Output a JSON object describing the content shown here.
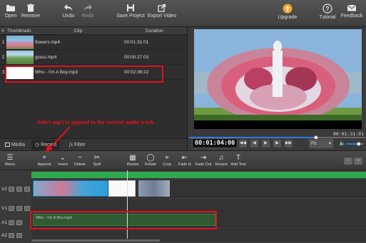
{
  "toolbar": {
    "open": "Open",
    "remove": "Remove",
    "undo": "Undo",
    "redo": "Redo",
    "save_project": "Save Project",
    "export_video": "Export Video",
    "upgrade": "Upgrade",
    "tutorial": "Tutorial",
    "feedback": "Feedback"
  },
  "media": {
    "columns": {
      "num": "#",
      "thumbnails": "Thumbnails",
      "clip": "Clip",
      "duration": "Duration"
    },
    "rows": [
      {
        "num": "1",
        "clip": "flowers.mp4",
        "duration": "00:01:31:01"
      },
      {
        "num": "2",
        "clip": "grass.mp4",
        "duration": "00:00:27:03"
      },
      {
        "num": "3",
        "clip": "Who - I'm A Boy.mp3",
        "duration": "00:02:36:22"
      }
    ],
    "tabs": {
      "media": "Media",
      "recent": "Recent",
      "filter": "Filter"
    }
  },
  "preview": {
    "duration": "00:01:31:01",
    "current_time": "00:01:04:00",
    "fit": "Fit",
    "progress": 0.72,
    "volume": 0.7
  },
  "annotation": "Select mp3 to append to the current audio track",
  "timeline_toolbar": {
    "menu": "Menu",
    "append": "Append",
    "insert": "Insert",
    "delete": "Delete",
    "split": "Split",
    "resize": "Resize",
    "rotate": "Rotate",
    "crop": "Crop",
    "fade_in": "Fade In",
    "fade_out": "Fade Out",
    "volume": "Volume",
    "add_text": "Add Text"
  },
  "timeline": {
    "tracks": [
      {
        "name": "V2"
      },
      {
        "name": "V1"
      },
      {
        "name": "A1"
      },
      {
        "name": "A2"
      }
    ],
    "audio_clip_label": "Who - I'm A Boy.mp3"
  },
  "colors": {
    "accent_green": "#2fa84f",
    "annotation_red": "#e0101a",
    "audio_clip": "#2f5a32",
    "progress_blue": "#2a7de1",
    "upgrade_orange": "#f5a623"
  }
}
